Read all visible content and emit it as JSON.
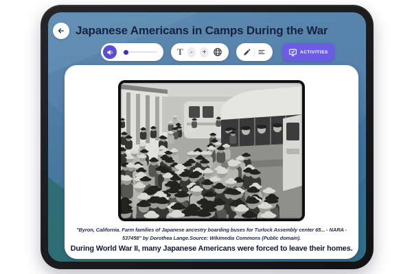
{
  "colors": {
    "accent_purple": "#5b4cd6",
    "activities_purple": "#6a5de4",
    "title_navy": "#18213d",
    "header_blue": "#5e8bb1",
    "bottom_teal": "#327078",
    "card_white": "#ffffff"
  },
  "header": {
    "back_icon": "arrow-left-icon",
    "title": "Japanese Americans in Camps During the War"
  },
  "toolbar": {
    "volume": {
      "icon": "speaker-icon",
      "value_percent": 8
    },
    "font_controls": {
      "size_label": "T",
      "decrease_label": "-",
      "increase_label": "+",
      "globe_icon": "globe-icon"
    },
    "tools": {
      "pen_icon": "pen-icon",
      "list_icon": "list-icon"
    },
    "activities": {
      "icon": "monitor-check-icon",
      "label": "ACTIVITIES"
    }
  },
  "content": {
    "photo_alt": "Black-and-white photograph of a crowd of Japanese American families boarding buses",
    "caption": "\"Byron, California. Farm families of Japanese ancestry boarding buses for Turlock Assembly center 65... - NARA - 537458\" by Dorothea Lange.Source: Wikimedia Commons (Public domain).",
    "body_text": "During World War II, many Japanese Americans were forced to leave their homes."
  }
}
